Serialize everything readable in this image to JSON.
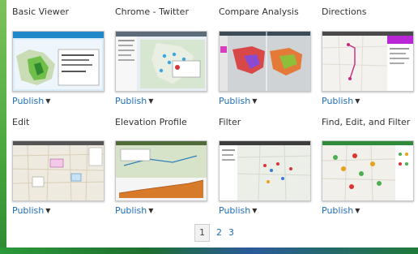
{
  "gallery": {
    "items": [
      {
        "title": "Basic Viewer",
        "publish_label": "Publish"
      },
      {
        "title": "Chrome - Twitter",
        "publish_label": "Publish"
      },
      {
        "title": "Compare Analysis",
        "publish_label": "Publish"
      },
      {
        "title": "Directions",
        "publish_label": "Publish"
      },
      {
        "title": "Edit",
        "publish_label": "Publish"
      },
      {
        "title": "Elevation Profile",
        "publish_label": "Publish"
      },
      {
        "title": "Filter",
        "publish_label": "Publish"
      },
      {
        "title": "Find, Edit, and Filter",
        "publish_label": "Publish"
      }
    ]
  },
  "pagination": {
    "pages": [
      "1",
      "2",
      "3"
    ],
    "current": "1"
  },
  "icons": {
    "publish_caret": "caret-down-icon"
  },
  "colors": {
    "link": "#1f6eb8",
    "background_green": "#2f9c3a"
  }
}
